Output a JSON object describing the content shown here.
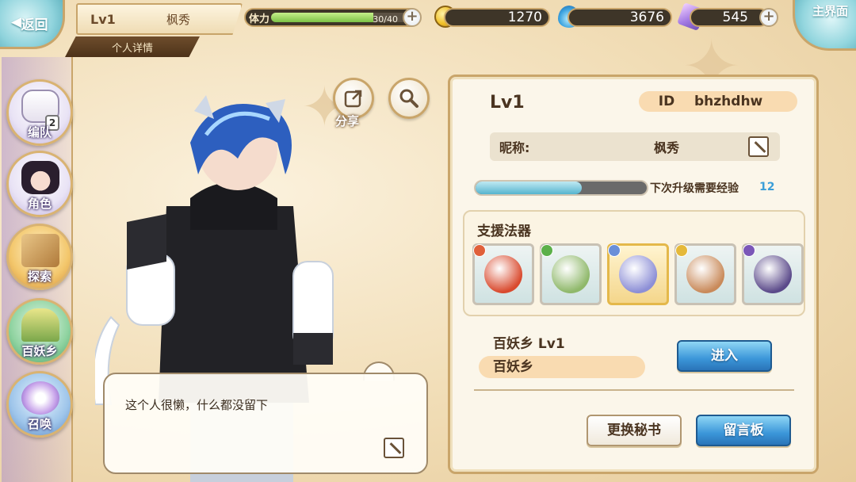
{
  "header": {
    "back_label": "返回",
    "player_level": "Lv1",
    "player_name": "枫秀",
    "detail_tab": "个人详情",
    "main_label": "主界面"
  },
  "resources": {
    "stamina": {
      "label": "体力",
      "value": "30/40",
      "fraction": 0.75
    },
    "coins": "1270",
    "flames": "3676",
    "crystals": "545"
  },
  "nav": [
    {
      "label": "编队",
      "badge": "2"
    },
    {
      "label": "角色"
    },
    {
      "label": "探索"
    },
    {
      "label": "百妖乡"
    },
    {
      "label": "召唤"
    }
  ],
  "actions": {
    "share_label": "分享"
  },
  "bubble": {
    "text": "这个人很懒，什么都没留下"
  },
  "profile": {
    "level": "Lv1",
    "id_label": "ID",
    "id_value": "bhzhdhw",
    "nick_label": "昵称:",
    "nick_value": "枫秀",
    "exp_label": "下次升级需要经验",
    "exp_value": "12",
    "exp_fraction": 0.62,
    "artifacts_title": "支援法器",
    "artifacts": [
      {
        "element_color": "#e0603a",
        "art_color": "#d94a2e"
      },
      {
        "element_color": "#5bb04a",
        "art_color": "#8fb86a"
      },
      {
        "element_color": "#6a8fd8",
        "art_color": "#8d8fd6",
        "selected": true
      },
      {
        "element_color": "#e5b93a",
        "art_color": "#c98a5a"
      },
      {
        "element_color": "#7b57b8",
        "art_color": "#5b4a8a"
      }
    ],
    "town_label": "百妖乡  Lv1",
    "town_name": "百妖乡",
    "enter_label": "进入",
    "change_secretary_label": "更换秘书",
    "message_board_label": "留言板"
  }
}
